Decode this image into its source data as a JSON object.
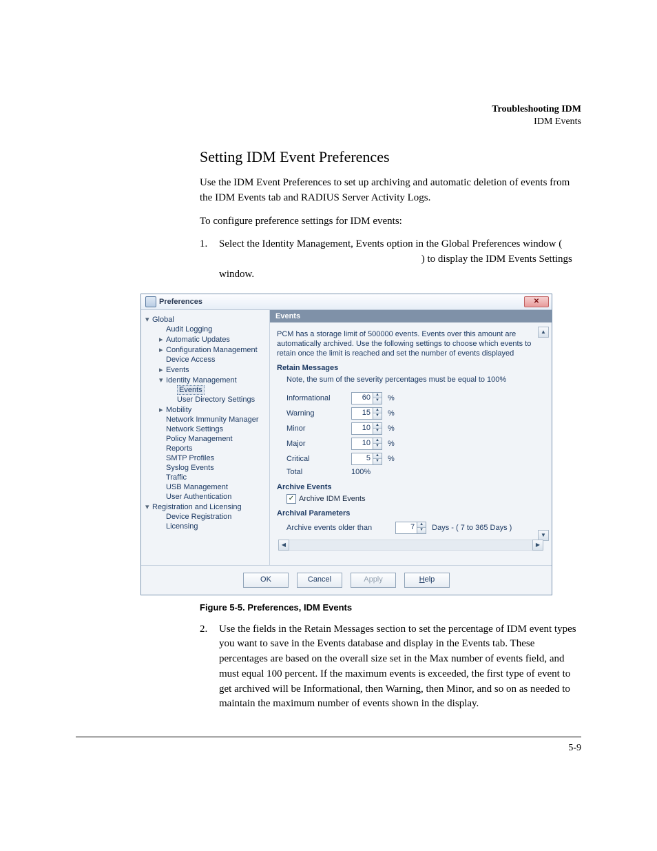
{
  "header": {
    "title": "Troubleshooting IDM",
    "subtitle": "IDM Events"
  },
  "section": {
    "title": "Setting IDM Event Preferences",
    "para1": "Use the IDM Event Preferences to set up archiving and automatic deletion of events from the IDM Events tab and RADIUS Server Activity Logs.",
    "para2": "To configure preference settings for IDM events:",
    "step1_num": "1.",
    "step1_text": "Select the Identity Management, Events option in the Global Preferences window (",
    "step1_tail": ") to display the IDM Events Settings window.",
    "step2_num": "2.",
    "step2_text": "Use the fields in the Retain Messages section to set the percentage of IDM event types you want to save in the Events database and display in the Events tab. These percentages are based on the overall size set in the Max number of events field, and must equal 100 percent. If the maximum events is exceeded, the first type of event to get archived will be Informational, then Warning, then Minor, and so on as needed to maintain the maximum number of events shown in the display."
  },
  "dialog": {
    "title": "Preferences",
    "close": "✕",
    "tree": [
      {
        "level": 0,
        "exp": "▾",
        "label": "Global"
      },
      {
        "level": 1,
        "exp": "",
        "label": "Audit Logging"
      },
      {
        "level": 1,
        "exp": "▸",
        "label": "Automatic Updates"
      },
      {
        "level": 1,
        "exp": "▸",
        "label": "Configuration Management"
      },
      {
        "level": 1,
        "exp": "",
        "label": "Device Access"
      },
      {
        "level": 1,
        "exp": "▸",
        "label": "Events"
      },
      {
        "level": 1,
        "exp": "▾",
        "label": "Identity Management"
      },
      {
        "level": 2,
        "exp": "",
        "label": "Events",
        "selected": true
      },
      {
        "level": 2,
        "exp": "",
        "label": "User Directory Settings"
      },
      {
        "level": 1,
        "exp": "▸",
        "label": "Mobility"
      },
      {
        "level": 1,
        "exp": "",
        "label": "Network Immunity Manager"
      },
      {
        "level": 1,
        "exp": "",
        "label": "Network Settings"
      },
      {
        "level": 1,
        "exp": "",
        "label": "Policy Management"
      },
      {
        "level": 1,
        "exp": "",
        "label": "Reports"
      },
      {
        "level": 1,
        "exp": "",
        "label": "SMTP Profiles"
      },
      {
        "level": 1,
        "exp": "",
        "label": "Syslog Events"
      },
      {
        "level": 1,
        "exp": "",
        "label": "Traffic"
      },
      {
        "level": 1,
        "exp": "",
        "label": "USB Management"
      },
      {
        "level": 1,
        "exp": "",
        "label": "User Authentication"
      },
      {
        "level": 0,
        "exp": "▾",
        "label": "Registration and Licensing"
      },
      {
        "level": 1,
        "exp": "",
        "label": "Device Registration"
      },
      {
        "level": 1,
        "exp": "",
        "label": "Licensing"
      }
    ],
    "pane": {
      "header": "Events",
      "intro": "PCM has a storage limit of 500000 events. Events over this amount are automatically archived. Use the following settings to choose which events to retain once the limit is reached and set the number of events displayed",
      "retain_title": "Retain Messages",
      "retain_note": "Note, the sum of the severity percentages must be equal to 100%",
      "rows": [
        {
          "label": "Informational",
          "value": "60",
          "suffix": "%"
        },
        {
          "label": "Warning",
          "value": "15",
          "suffix": "%"
        },
        {
          "label": "Minor",
          "value": "10",
          "suffix": "%"
        },
        {
          "label": "Major",
          "value": "10",
          "suffix": "%"
        },
        {
          "label": "Critical",
          "value": "5",
          "suffix": "%"
        }
      ],
      "total_label": "Total",
      "total_value": "100%",
      "archive_title": "Archive Events",
      "archive_checkbox": "Archive IDM Events",
      "archival_params_title": "Archival Parameters",
      "archive_older_label": "Archive events older than",
      "archive_older_value": "7",
      "archive_older_suffix": "Days  -  ( 7 to 365 Days )"
    },
    "buttons": {
      "ok": "OK",
      "cancel": "Cancel",
      "apply": "Apply",
      "help_pre": "H",
      "help_post": "elp"
    }
  },
  "figure_caption": "Figure 5-5. Preferences, IDM Events",
  "page_number": "5-9"
}
